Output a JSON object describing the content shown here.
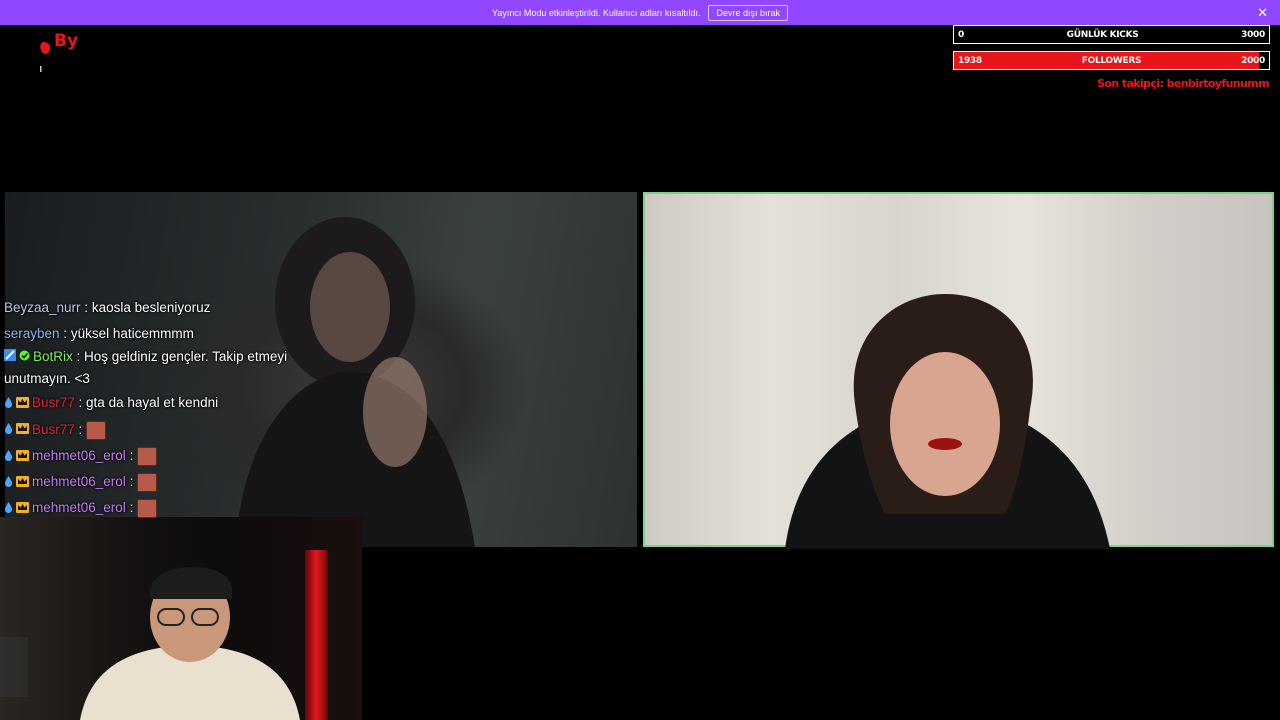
{
  "banner": {
    "text": "Yayıncı Modu etkinleştirildi. Kullanıcı adları kısaltıldı.",
    "button_label": "Devre dışı bırak",
    "close_glyph": "✕"
  },
  "logo": {
    "label": "By"
  },
  "stats": {
    "kicks": {
      "current": "0",
      "label": "GÜNLÜK KICKS",
      "goal": "3000"
    },
    "followers": {
      "current": "1938",
      "label": "FOLLOWERS",
      "goal": "2000",
      "progress_fraction": 0.969
    },
    "last_follower": "Son takipçi: benbirtoyfunumm"
  },
  "chat": [
    {
      "user": "Beyzaa_nurr",
      "color": "#b5c8e8",
      "sep": " : ",
      "text": "kaosla besleniyoruz"
    },
    {
      "user": "serayben",
      "color": "#8fb3e6",
      "sep": " : ",
      "text": "yüksel haticemmmm"
    },
    {
      "user": "BotRix",
      "color": "#7bf25b",
      "sep": " : ",
      "text": "Hoş geldiniz gençler. Takip etmeyi unutmayın. <3",
      "badges": [
        "bot-icon",
        "verified-icon"
      ]
    },
    {
      "user": "Busr77",
      "color": "#e0243b",
      "sep": " : ",
      "text": "gta da hayal et kendni",
      "badges": [
        "drop-icon",
        "crown-icon"
      ]
    },
    {
      "user": "Busr77",
      "color": "#e0243b",
      "sep": " : ",
      "text": "",
      "emote": true,
      "badges": [
        "drop-icon",
        "crown-icon"
      ]
    },
    {
      "user": "mehmet06_erol",
      "color": "#c37cf0",
      "sep": " : ",
      "text": "",
      "emote": true,
      "badges": [
        "drop-icon",
        "crown-icon"
      ]
    },
    {
      "user": "mehmet06_erol",
      "color": "#c37cf0",
      "sep": " : ",
      "text": "",
      "emote": true,
      "badges": [
        "drop-icon",
        "crown-icon"
      ]
    },
    {
      "user": "mehmet06_erol",
      "color": "#c37cf0",
      "sep": " : ",
      "text": "",
      "emote": true,
      "badges": [
        "drop-icon",
        "crown-icon"
      ]
    }
  ],
  "colors": {
    "banner": "#9147ff",
    "accent_red": "#e6161b",
    "active_border": "#7bd389"
  }
}
